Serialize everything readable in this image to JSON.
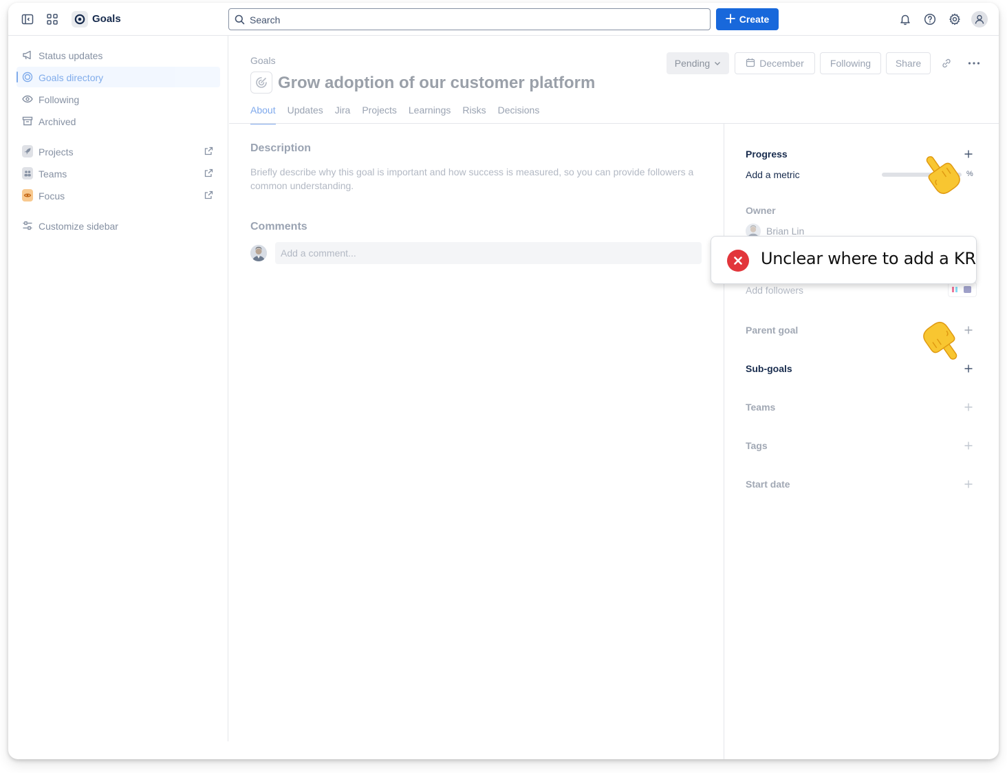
{
  "app": {
    "name": "Goals"
  },
  "search": {
    "placeholder": "Search"
  },
  "create_button": {
    "label": "Create"
  },
  "colors": {
    "brand": "#1868db",
    "error": "#e2363b",
    "focus_chip": "#f5a54a"
  },
  "sidebar": {
    "items": [
      {
        "label": "Status updates",
        "icon": "megaphone-icon"
      },
      {
        "label": "Goals directory",
        "icon": "target-icon",
        "active": true
      },
      {
        "label": "Following",
        "icon": "eye-icon"
      },
      {
        "label": "Archived",
        "icon": "archive-icon"
      }
    ],
    "apps": [
      {
        "label": "Projects",
        "icon": "rocket-icon"
      },
      {
        "label": "Teams",
        "icon": "people-icon"
      },
      {
        "label": "Focus",
        "icon": "focus-icon"
      }
    ],
    "customize": {
      "label": "Customize sidebar",
      "icon": "sliders-icon"
    }
  },
  "goal": {
    "breadcrumb": "Goals",
    "title": "Grow adoption of our customer platform",
    "status": "Pending",
    "date": "December",
    "following": "Following",
    "share": "Share"
  },
  "tabs": [
    "About",
    "Updates",
    "Jira",
    "Projects",
    "Learnings",
    "Risks",
    "Decisions"
  ],
  "about": {
    "description_title": "Description",
    "description_placeholder": "Briefly describe why this goal is important and how success is measured, so you can provide followers a common understanding.",
    "comments_title": "Comments",
    "comment_placeholder": "Add a comment..."
  },
  "panel": {
    "progress_label": "Progress",
    "metric_label": "Add a metric",
    "metric_unit": "%",
    "progress_fraction": 0,
    "owner_label": "Owner",
    "owner_name": "Brian Lin",
    "followers_text": "Add followers",
    "parent_goal_label": "Parent goal",
    "subgoals_label": "Sub-goals",
    "teams_label": "Teams",
    "tags_label": "Tags",
    "start_date_label": "Start date"
  },
  "callout": {
    "text": "Unclear where to add a KR"
  }
}
